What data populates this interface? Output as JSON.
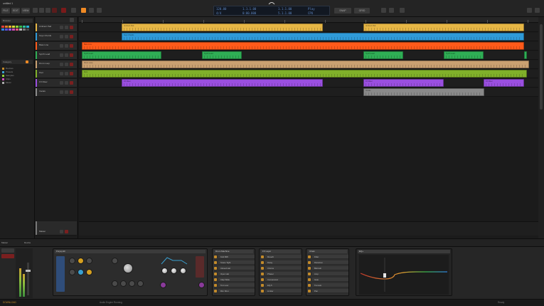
{
  "window": {
    "title": "untitled 1"
  },
  "toolbar": {
    "left_buttons": [
      "FILE",
      "EDIT",
      "VIEW"
    ],
    "mode_buttons": [
      "ARRANGE",
      "MIX",
      "EDIT"
    ],
    "right_buttons": [
      "SNAP",
      "GRID"
    ],
    "accent": "#f08a24"
  },
  "transport": {
    "tempo": "120.00",
    "time_signature": "4/4",
    "position": "1.1.1.00",
    "time": "0:00.000",
    "loop_start": "1.1.1.00",
    "loop_end": "5.1.1.00",
    "cpu": "CPU",
    "mode": "Play"
  },
  "browser": {
    "label": "Browser",
    "palette": [
      "#e03b3b",
      "#e07a2b",
      "#e6b22e",
      "#d9d93a",
      "#8fcf3a",
      "#3ab54a",
      "#2fbf9a",
      "#2ab0d8",
      "#2f7fe0",
      "#5a4fe0",
      "#9a4fe0",
      "#d04fb8",
      "#e04f7f",
      "#b8b8b8",
      "#7a7a7a",
      "#4a4a4a"
    ],
    "category_label": "Category",
    "items": [
      "Devices",
      "Presets",
      "Samples",
      "Clips",
      "Music"
    ],
    "icon_colors": [
      "#c28a2a",
      "#3aa0d0",
      "#8fcf3a",
      "#d04fb8",
      "#aaaaaa"
    ]
  },
  "tracks": [
    {
      "name": "Ambient Pad",
      "color": "#e6b645"
    },
    {
      "name": "Keys Chords",
      "color": "#2f9ad8"
    },
    {
      "name": "Bass Line",
      "color": "#ff5a1a"
    },
    {
      "name": "Synth Lead",
      "color": "#2fae55"
    },
    {
      "name": "Drum Loop",
      "color": "#c9a071"
    },
    {
      "name": "Perc",
      "color": "#80b02a"
    },
    {
      "name": "FX Riser",
      "color": "#9a4fe0"
    },
    {
      "name": "Vocals",
      "color": "#8a8a8a"
    }
  ],
  "clips": [
    {
      "track": 0,
      "start": 60,
      "length": 283,
      "label": "Ambient Pad"
    },
    {
      "track": 0,
      "start": 400,
      "length": 226,
      "label": "Ambient Pad"
    },
    {
      "track": 1,
      "start": 60,
      "length": 566,
      "label": "Keys Chords"
    },
    {
      "track": 2,
      "start": 4,
      "length": 622,
      "label": "Bass Line"
    },
    {
      "track": 3,
      "start": 4,
      "length": 112,
      "label": "Synth Lead"
    },
    {
      "track": 3,
      "start": 173,
      "length": 56,
      "label": "Synth Lead"
    },
    {
      "track": 3,
      "start": 400,
      "length": 56,
      "label": "Synth Lead"
    },
    {
      "track": 3,
      "start": 513,
      "length": 56,
      "label": "Synth Lead"
    },
    {
      "track": 3,
      "start": 626,
      "length": 4,
      "label": ""
    },
    {
      "track": 4,
      "start": 4,
      "length": 629,
      "label": "Drum Loop"
    },
    {
      "track": 5,
      "start": 4,
      "length": 626,
      "label": "Perc"
    },
    {
      "track": 6,
      "start": 60,
      "length": 283,
      "label": "FX Riser"
    },
    {
      "track": 6,
      "start": 400,
      "length": 113,
      "label": "FX Riser"
    },
    {
      "track": 6,
      "start": 569,
      "length": 57,
      "label": "FX Riser"
    },
    {
      "track": 7,
      "start": 400,
      "length": 170,
      "label": "Vocals"
    }
  ],
  "master": {
    "name": "Master"
  },
  "bottom_tabs": [
    "Master",
    "Device"
  ],
  "devices": [
    {
      "title": "Polysynth",
      "type": "synth"
    },
    {
      "title": "Drum Machine",
      "type": "list",
      "rows": [
        "Kick 808",
        "Snare Tight",
        "Closed Hat",
        "Open Hat",
        "Clap Wide",
        "Tom Low",
        "Rim Shot"
      ]
    },
    {
      "title": "FX Layer",
      "type": "list",
      "rows": [
        "Reverb",
        "Delay",
        "Chorus",
        "Phaser",
        "Compressor",
        "EQ-5",
        "Limiter"
      ]
    },
    {
      "title": "Chain",
      "type": "list",
      "rows": [
        "Filter",
        "Distortion",
        "Bitcrush",
        "Amp",
        "Gate",
        "Tremolo",
        "Pan"
      ]
    },
    {
      "title": "EQ+",
      "type": "eq"
    }
  ],
  "status": {
    "left": "DOWNLOAD",
    "middle": "Audio Engine Running",
    "right": "Ready"
  }
}
